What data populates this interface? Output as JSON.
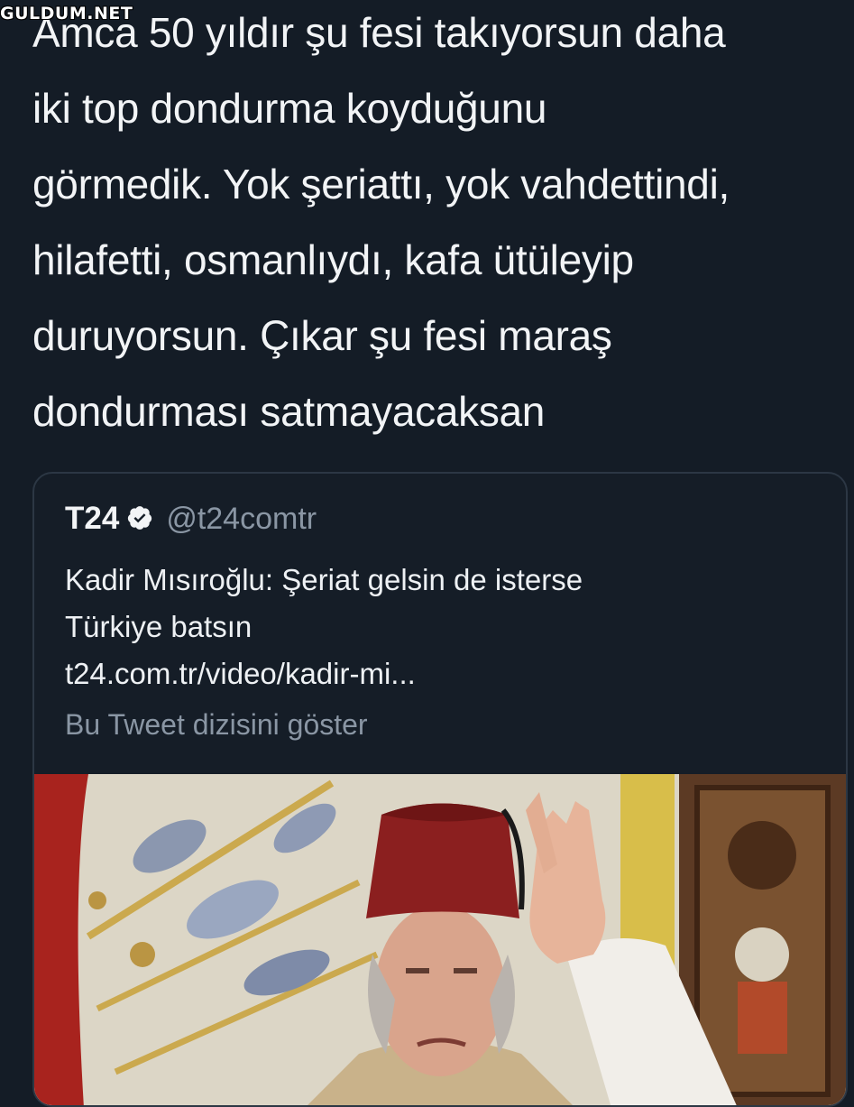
{
  "watermark": "GULDUM.NET",
  "tweet": {
    "lines": [
      "Amca 50 yıldır şu fesi takıyorsun daha",
      "iki top dondurma koyduğunu",
      "görmedik. Yok şeriattı, yok vahdettindi,",
      "hilafetti, osmanlıydı, kafa ütüleyip",
      "duruyorsun. Çıkar şu fesi maraş",
      "dondurması satmayacaksan"
    ]
  },
  "quoted": {
    "name": "T24",
    "verified_icon": "verified-badge-icon",
    "handle": "@t24comtr",
    "text_lines": [
      "Kadir Mısıroğlu: Şeriat gelsin de isterse",
      "Türkiye batsın"
    ],
    "link": "t24.com.tr/video/kadir-mi...",
    "thread_label": "Bu Tweet dizisini göster",
    "media": "video-thumbnail-man-in-fez"
  },
  "colors": {
    "background": "#141c26",
    "text": "#f2f4f6",
    "secondary": "#8a96a4",
    "card_border": "#2c3744"
  }
}
